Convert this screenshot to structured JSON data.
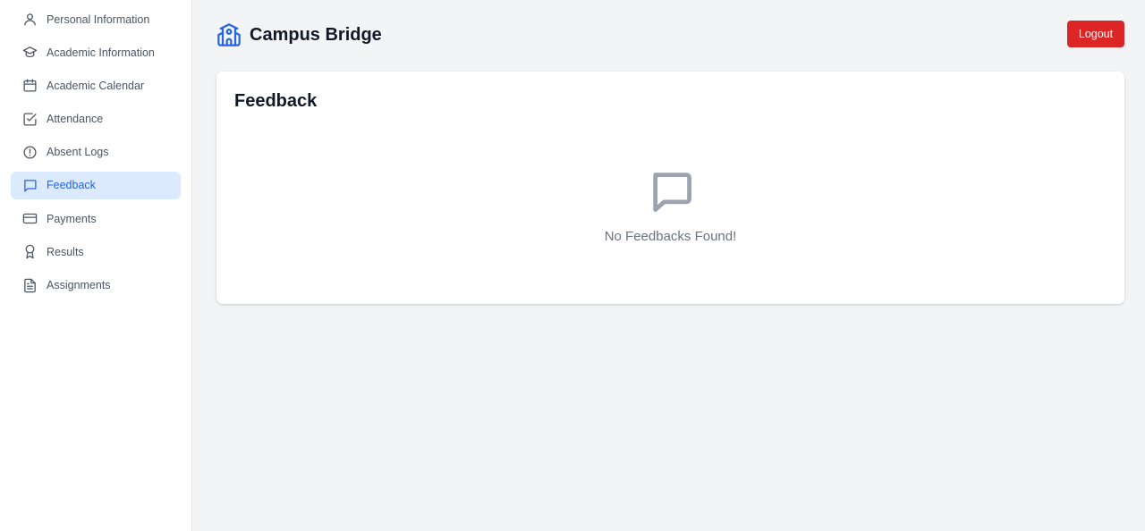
{
  "sidebar": {
    "items": [
      {
        "label": "Personal Information",
        "icon": "user-icon"
      },
      {
        "label": "Academic Information",
        "icon": "graduation-cap-icon"
      },
      {
        "label": "Academic Calendar",
        "icon": "calendar-icon"
      },
      {
        "label": "Attendance",
        "icon": "checkbox-icon"
      },
      {
        "label": "Absent Logs",
        "icon": "alert-circle-icon"
      },
      {
        "label": "Feedback",
        "icon": "message-square-icon",
        "active": true
      },
      {
        "label": "Payments",
        "icon": "credit-card-icon"
      },
      {
        "label": "Results",
        "icon": "award-icon"
      },
      {
        "label": "Assignments",
        "icon": "file-text-icon"
      }
    ]
  },
  "header": {
    "title": "Campus Bridge",
    "logo_icon": "school-icon",
    "logout_label": "Logout"
  },
  "main": {
    "card_title": "Feedback",
    "empty_icon": "message-square-icon",
    "empty_text": "No Feedbacks Found!"
  },
  "colors": {
    "accent": "#2563eb",
    "active_bg": "#dbeafe",
    "logout": "#dc2626",
    "page_bg": "#f3f4f6"
  }
}
